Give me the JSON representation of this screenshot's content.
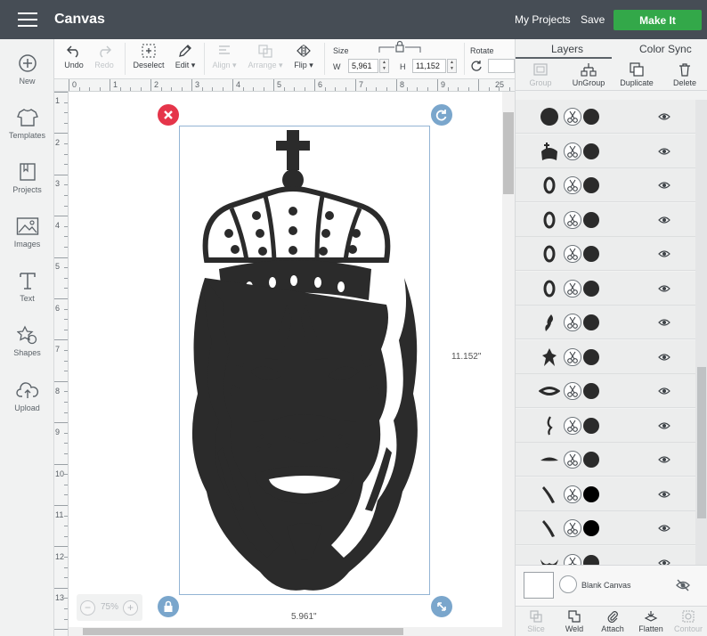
{
  "topbar": {
    "title": "Canvas",
    "my_projects": "My Projects",
    "save": "Save",
    "make_it": "Make It",
    "make_it_color": "#33a849",
    "bar_color": "#464d55"
  },
  "sidebar": {
    "items": [
      {
        "label": "New",
        "icon": "plus-circle-icon"
      },
      {
        "label": "Templates",
        "icon": "shirt-icon"
      },
      {
        "label": "Projects",
        "icon": "book-icon"
      },
      {
        "label": "Images",
        "icon": "image-icon"
      },
      {
        "label": "Text",
        "icon": "text-icon"
      },
      {
        "label": "Shapes",
        "icon": "shapes-icon"
      },
      {
        "label": "Upload",
        "icon": "cloud-upload-icon"
      }
    ]
  },
  "toolbar": {
    "undo": "Undo",
    "redo": "Redo",
    "deselect": "Deselect",
    "edit": "Edit",
    "align": "Align",
    "arrange": "Arrange",
    "flip": "Flip",
    "size_label": "Size",
    "w_label": "W",
    "h_label": "H",
    "width": "5,961",
    "height": "11,152",
    "rotate_label": "Rotate"
  },
  "ruler": {
    "horizontal": [
      "0",
      "1",
      "2",
      "3",
      "4",
      "5",
      "6",
      "7",
      "8",
      "9",
      "25"
    ],
    "vertical": [
      "1",
      "2",
      "3",
      "4",
      "5",
      "6",
      "7",
      "8",
      "9",
      "10",
      "11",
      "12",
      "13"
    ]
  },
  "canvas": {
    "height_dim": "11.152\"",
    "width_dim": "5.961\"",
    "zoom": "75%",
    "selection_color": "#93b4d4",
    "delete_handle_color": "#e5354a"
  },
  "panel": {
    "tabs": [
      "Layers",
      "Color Sync"
    ],
    "actions": [
      "Group",
      "UnGroup",
      "Duplicate",
      "Delete"
    ],
    "layers": [
      {
        "thumb": "circle-shape",
        "color": "#2b2b2b"
      },
      {
        "thumb": "lion-full-shape",
        "color": "#2b2b2b"
      },
      {
        "thumb": "ring-shape",
        "color": "#2b2b2b"
      },
      {
        "thumb": "ring-shape",
        "color": "#2b2b2b"
      },
      {
        "thumb": "ring-shape",
        "color": "#2b2b2b"
      },
      {
        "thumb": "ring-shape",
        "color": "#2b2b2b"
      },
      {
        "thumb": "mane-piece-shape",
        "color": "#2b2b2b"
      },
      {
        "thumb": "mane-tuft-shape",
        "color": "#2b2b2b"
      },
      {
        "thumb": "crown-band-shape",
        "color": "#2b2b2b"
      },
      {
        "thumb": "curl-shape",
        "color": "#2b2b2b"
      },
      {
        "thumb": "eyelid-shape",
        "color": "#2b2b2b"
      },
      {
        "thumb": "stroke-shape",
        "color": "#000000"
      },
      {
        "thumb": "stroke-shape",
        "color": "#000000"
      },
      {
        "thumb": "mustache-shape",
        "color": "#2b2b2b"
      }
    ],
    "blank_canvas": "Blank Canvas",
    "bottom": [
      "Slice",
      "Weld",
      "Attach",
      "Flatten",
      "Contour"
    ]
  }
}
